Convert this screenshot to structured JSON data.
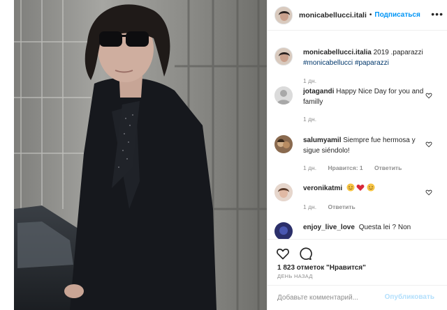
{
  "header": {
    "username": "monicabellucci.itali",
    "separator": "•",
    "follow_label": "Подписаться",
    "more_icon": "more-horizontal-icon"
  },
  "caption": {
    "username": "monicabellucci.italia",
    "text": "2019 .paparazzi",
    "tags": [
      "#monicabellucci",
      "#paparazzi"
    ],
    "time": "1 дн."
  },
  "comments": [
    {
      "username": "jotagandi",
      "text": "Happy Nice Day for you and familly",
      "time": "1 дн.",
      "likes": "",
      "reply": "Ответить"
    },
    {
      "username": "salumyamil",
      "text": "Siempre fue hermosa y sigue siéndolo!",
      "time": "1 дн.",
      "likes": "Нравится: 1",
      "reply": "Ответить"
    },
    {
      "username": "veronikatmi",
      "text": "",
      "emoji_icons": [
        "blushing-face-icon",
        "hearts-icon",
        "smiling-face-icon"
      ],
      "time": "1 дн.",
      "likes": "",
      "reply": "Ответить"
    },
    {
      "username": "enjoy_live_love",
      "text": "Questa lei ? Non"
    }
  ],
  "actions": {
    "icons": [
      "heart-icon",
      "comment-icon"
    ]
  },
  "likes_text": "1 823 отметок \"Нравится\"",
  "time_ago": "ДЕНЬ НАЗАД",
  "add_comment": {
    "placeholder": "Добавьте комментарий...",
    "publish_label": "Опубликовать"
  },
  "colors": {
    "link_blue": "#0095f6",
    "publish_disabled": "#b2dffc",
    "tag_blue": "#00376b",
    "meta_gray": "#8e8e8e",
    "text": "#262626"
  }
}
